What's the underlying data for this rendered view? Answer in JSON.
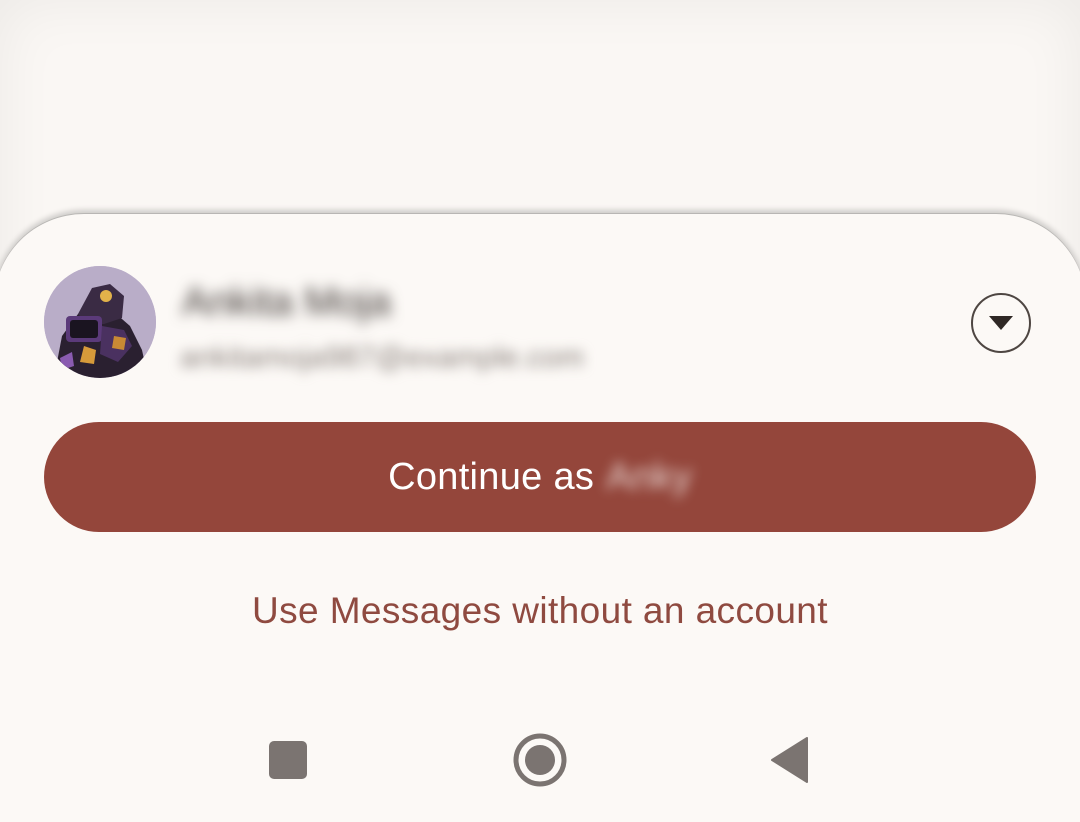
{
  "account": {
    "name": "Ankita Moja",
    "email": "ankitamoja987@example.com"
  },
  "actions": {
    "continue_prefix": "Continue as",
    "continue_name": "Anky",
    "no_account_label": "Use Messages without an account"
  },
  "icons": {
    "dropdown": "chevron-down-circle-icon",
    "recents": "square-recents-icon",
    "home": "circle-home-icon",
    "back": "triangle-back-icon"
  },
  "colors": {
    "primary": "#94463b",
    "link": "#8f4a40",
    "surface": "#fcf9f6",
    "nav_icon": "#7b7471"
  }
}
